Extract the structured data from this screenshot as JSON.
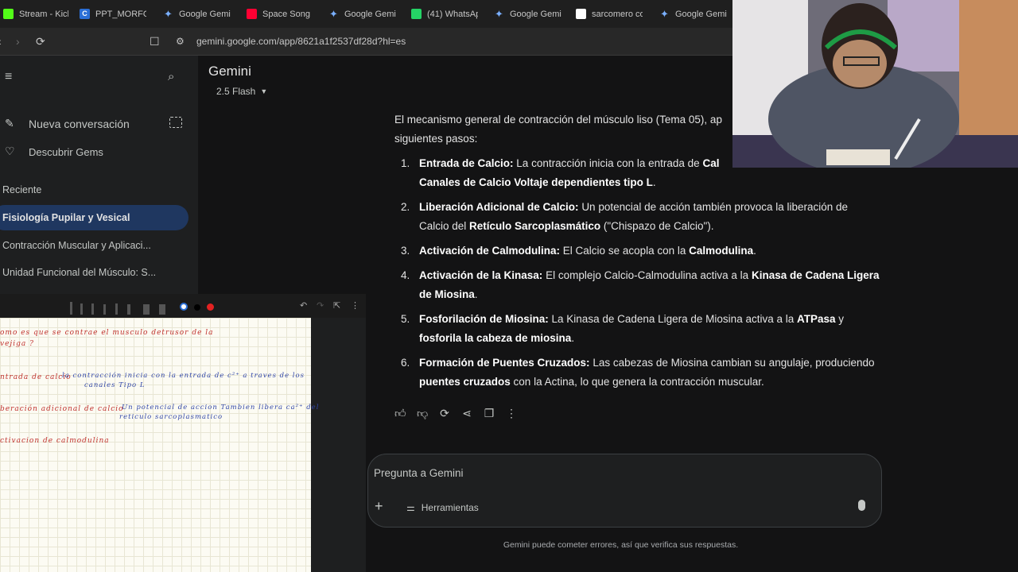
{
  "browser": {
    "tabs": [
      {
        "title": "Stream - Kick",
        "icon": "kick-icon"
      },
      {
        "title": "PPT_MORFOFI",
        "icon": "c-icon"
      },
      {
        "title": "Google Gemi",
        "icon": "gemini-icon"
      },
      {
        "title": "Space Song -",
        "icon": "youtube-icon"
      },
      {
        "title": "Google Gemi",
        "icon": "gemini-icon"
      },
      {
        "title": "(41) WhatsAp",
        "icon": "whatsapp-icon"
      },
      {
        "title": "Google Gemi",
        "icon": "gemini-icon"
      },
      {
        "title": "sarcomero co",
        "icon": "google-icon"
      },
      {
        "title": "Google Gemi",
        "icon": "gemini-icon"
      }
    ],
    "url": "gemini.google.com/app/8621a1f2537df28d?hl=es"
  },
  "sidebar": {
    "new_chat": "Nueva conversación",
    "discover_gems": "Descubrir Gems",
    "recent_heading": "Reciente",
    "recent": [
      "Fisiología Pupilar y Vesical",
      "Contracción Muscular y Aplicaci...",
      "Unidad Funcional del Músculo: S..."
    ]
  },
  "main": {
    "title": "Gemini",
    "model": "2.5 Flash",
    "intro_a": "El mecanismo general de contracción del músculo liso (Tema 05), ap",
    "intro_b": "siguientes pasos:",
    "steps": [
      {
        "n": "1.",
        "title": "Entrada de Calcio:",
        "t1": "La contracción inicia con la entrada de",
        "b1": "Cal",
        "b2": "Canales de Calcio Voltaje dependientes tipo L",
        "end": "."
      },
      {
        "n": "2.",
        "title": "Liberación Adicional de Calcio:",
        "t1": "Un potencial de acción también provoca la liberación de Calcio del",
        "b1": "Retículo Sarcoplasmático",
        "t2": "(\"Chispazo de Calcio\")."
      },
      {
        "n": "3.",
        "title": "Activación de Calmodulina:",
        "t1": "El Calcio se acopla con la",
        "b1": "Calmodulina",
        "end": "."
      },
      {
        "n": "4.",
        "title": "Activación de la Kinasa:",
        "t1": "El complejo Calcio-Calmodulina activa a la",
        "b1": "Kinasa de Cadena Ligera de Miosina",
        "end": "."
      },
      {
        "n": "5.",
        "title": "Fosforilación de Miosina:",
        "t1": "La Kinasa de Cadena Ligera de Miosina activa a la",
        "b1": "ATPasa",
        "t2": "y",
        "b2": "fosforila la cabeza de miosina",
        "end": "."
      },
      {
        "n": "6.",
        "title": "Formación de Puentes Cruzados:",
        "t1": "Las cabezas de Miosina cambian su angulaje, produciendo",
        "b1": "puentes cruzados",
        "t2": "con la Actina, lo que genera la contracción muscular."
      }
    ],
    "composer_placeholder": "Pregunta a Gemini",
    "tools_label": "Herramientas",
    "disclaimer": "Gemini puede cometer errores, así que verifica sus respuestas."
  },
  "notes": {
    "lines": [
      {
        "text": "omo es que  se contrae  el  musculo  detrusor de la",
        "color": "red"
      },
      {
        "text": "vejiga ?",
        "color": "red"
      },
      {
        "text": "ntrada de calcio",
        "color": "red"
      },
      {
        "text": "la contracción inicia con la entrada de c²⁺  a  traves de los",
        "color": "blue"
      },
      {
        "text": "canales Tipo L",
        "color": "blue"
      },
      {
        "text": "beración adicional de calcio",
        "color": "red"
      },
      {
        "text": "Un potencial de accion Tambien libera  ca²⁺ del",
        "color": "blue"
      },
      {
        "text": "reticulo sarcoplasmatico",
        "color": "blue"
      },
      {
        "text": "ctivacion  de  calmodulina",
        "color": "red"
      }
    ]
  },
  "colors": {
    "background": "#131314",
    "sidebar": "#1e1f20",
    "active_item": "#1f3760",
    "ink_red": "#c0322e",
    "ink_blue": "#3046a8"
  }
}
